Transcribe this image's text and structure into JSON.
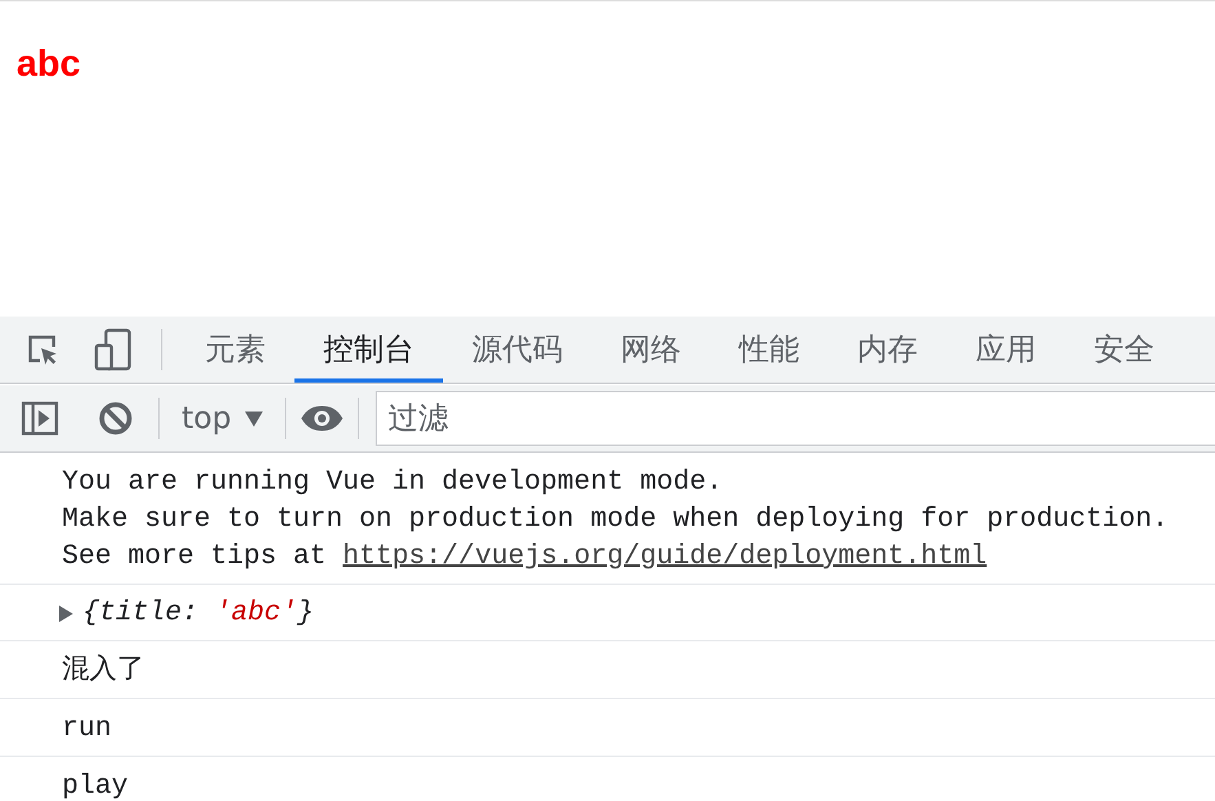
{
  "page": {
    "heading": "abc"
  },
  "devtools": {
    "tabs": [
      {
        "label": "元素",
        "selected": false
      },
      {
        "label": "控制台",
        "selected": true
      },
      {
        "label": "源代码",
        "selected": false
      },
      {
        "label": "网络",
        "selected": false
      },
      {
        "label": "性能",
        "selected": false
      },
      {
        "label": "内存",
        "selected": false
      },
      {
        "label": "应用",
        "selected": false
      },
      {
        "label": "安全",
        "selected": false
      }
    ],
    "toolbar": {
      "context": "top",
      "filter": {
        "placeholder": "过滤"
      }
    },
    "messages": [
      {
        "kind": "text",
        "lines": [
          "You are running Vue in development mode.",
          "Make sure to turn on production mode when deploying for production."
        ],
        "link_prefix": "See more tips at ",
        "link": "https://vuejs.org/guide/deployment.html"
      },
      {
        "kind": "object",
        "expanded": false,
        "prefix": "{title: ",
        "value": "'abc'",
        "suffix": "}"
      },
      {
        "kind": "text",
        "lines": [
          "混入了"
        ]
      },
      {
        "kind": "text",
        "lines": [
          "run"
        ]
      },
      {
        "kind": "text",
        "lines": [
          "play"
        ]
      }
    ]
  }
}
